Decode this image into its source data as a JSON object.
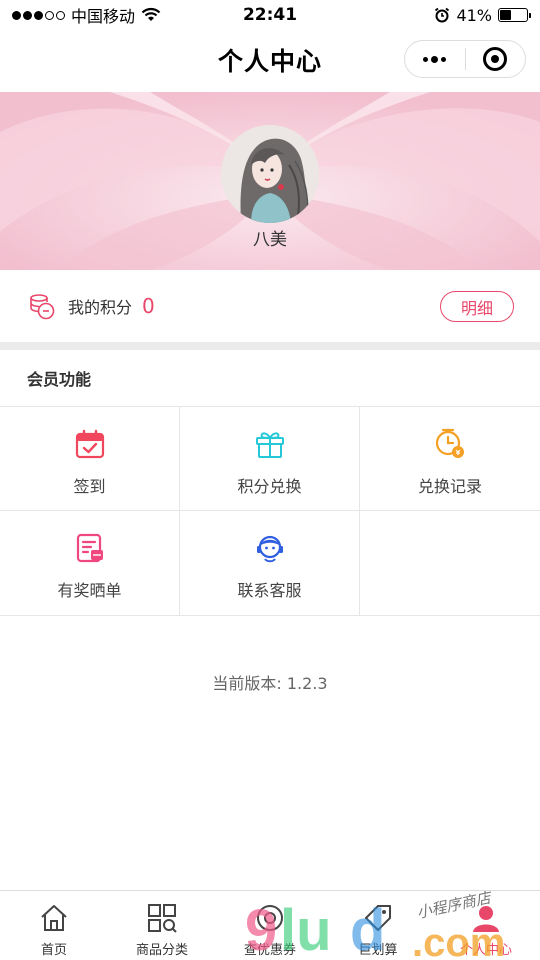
{
  "status_bar": {
    "carrier": "中国移动",
    "time": "22:41",
    "battery_percent": "41%",
    "battery_level": 0.41
  },
  "nav": {
    "title": "个人中心"
  },
  "profile": {
    "name": "八美"
  },
  "points": {
    "label": "我的积分",
    "value": "0",
    "detail_button": "明细"
  },
  "member": {
    "section_title": "会员功能",
    "items": [
      {
        "label": "签到",
        "icon": "calendar-check-icon",
        "color": "#f0475e"
      },
      {
        "label": "积分兑换",
        "icon": "gift-icon",
        "color": "#27c9d8"
      },
      {
        "label": "兑换记录",
        "icon": "clock-coin-icon",
        "color": "#f4a024"
      },
      {
        "label": "有奖晒单",
        "icon": "receipt-icon",
        "color": "#f0477f"
      },
      {
        "label": "联系客服",
        "icon": "customer-service-icon",
        "color": "#2f5fe0"
      }
    ]
  },
  "version": "当前版本: 1.2.3",
  "tabbar": {
    "items": [
      {
        "label": "首页",
        "icon": "home-icon"
      },
      {
        "label": "商品分类",
        "icon": "category-icon"
      },
      {
        "label": "查优惠券",
        "icon": "coupon-icon"
      },
      {
        "label": "巨划算",
        "icon": "tag-icon"
      },
      {
        "label": "个人中心",
        "icon": "profile-icon"
      }
    ],
    "active_color": "#e8476a"
  },
  "watermark": {
    "text": "小程序商店",
    "logo": "9lud.com"
  }
}
